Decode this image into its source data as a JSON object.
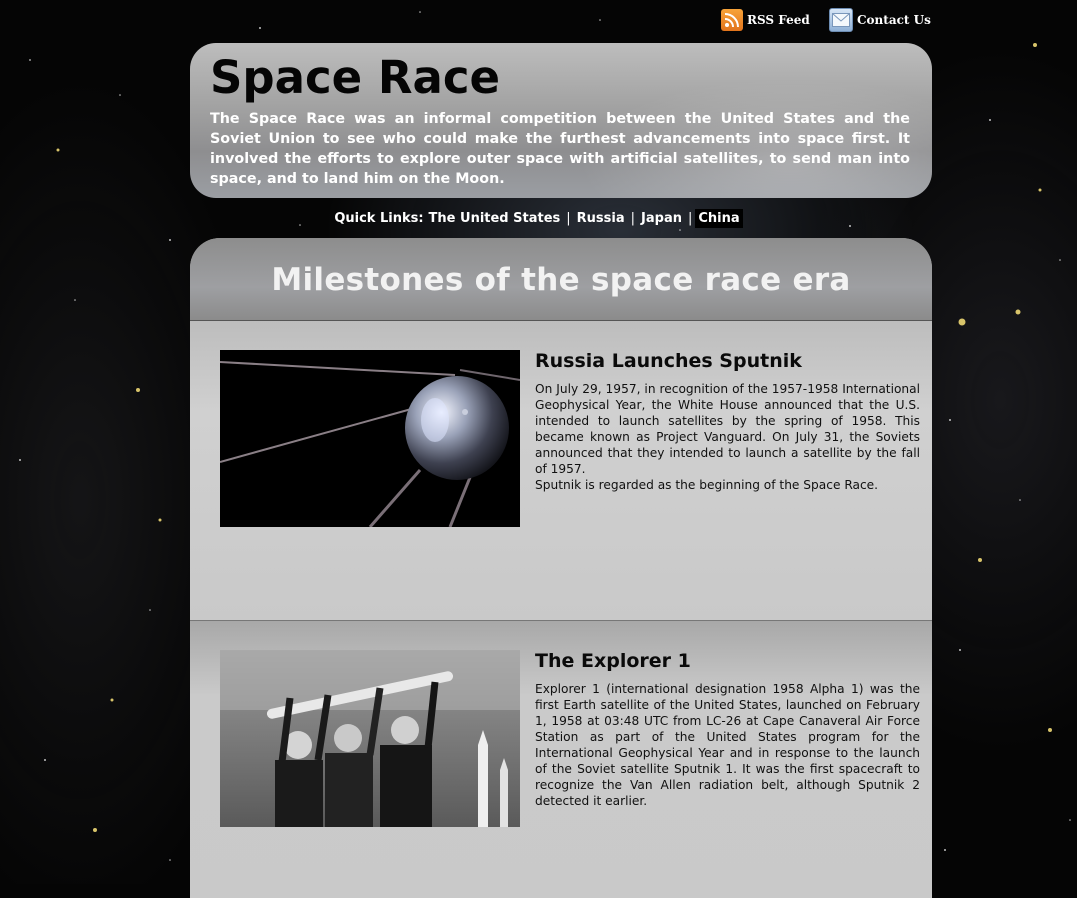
{
  "top_links": {
    "rss_label": "RSS Feed",
    "contact_label": "Contact Us",
    "rss_icon": "rss-icon",
    "contact_icon": "mail-icon"
  },
  "header": {
    "title": "Space Race",
    "description": "The Space Race was an informal competition between the United States and the Soviet Union to see who could make the furthest advancements into space first. It involved the efforts to explore outer space with artificial satellites, to send man into space, and to land him on the Moon."
  },
  "quick_links": {
    "label": "Quick Links:",
    "items": [
      "The United States",
      "Russia",
      "Japan",
      "China"
    ],
    "active": "China"
  },
  "main": {
    "heading": "Milestones of the space race era",
    "articles": [
      {
        "title": "Russia Launches Sputnik",
        "body": "On July 29, 1957, in recognition of the 1957-1958 International Geophysical Year, the White House announced that the U.S. intended to launch satellites by the spring of 1958. This became known as Project Vanguard. On July 31, the Soviets announced that they intended to launch a satellite by the fall of 1957.",
        "body2": "Sputnik is regarded as the beginning of the Space Race."
      },
      {
        "title": "The Explorer 1",
        "body": "Explorer 1 (international designation 1958 Alpha 1) was the first Earth satellite of the United States, launched on February 1, 1958 at 03:48 UTC from LC-26 at Cape Canaveral Air Force Station as part of the United States program for the International Geophysical Year and in response to the launch of the Soviet satellite Sputnik 1. It was the first spacecraft to recognize the Van Allen radiation belt, although Sputnik 2 detected it earlier."
      }
    ]
  },
  "colors": {
    "background": "#050505",
    "panel": "#c8c8c8",
    "text_light": "#ffffff",
    "text_dark": "#0a0a0a"
  }
}
